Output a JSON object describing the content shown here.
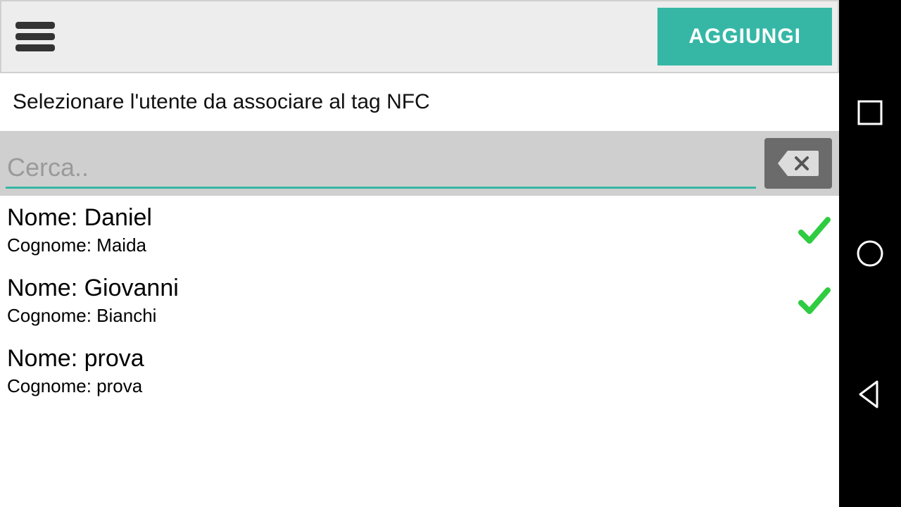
{
  "header": {
    "add_label": "AGGIUNGI"
  },
  "instruction": "Selezionare l'utente da associare al tag NFC",
  "search": {
    "placeholder": "Cerca..",
    "value": ""
  },
  "labels": {
    "name_label": "Nome:",
    "surname_label": "Cognome:"
  },
  "users": [
    {
      "name": "Daniel",
      "surname": "Maida",
      "checked": true
    },
    {
      "name": "Giovanni",
      "surname": "Bianchi",
      "checked": true
    },
    {
      "name": "prova",
      "surname": "prova",
      "checked": false
    }
  ],
  "colors": {
    "accent": "#36b7a6",
    "check": "#2ecc40"
  }
}
